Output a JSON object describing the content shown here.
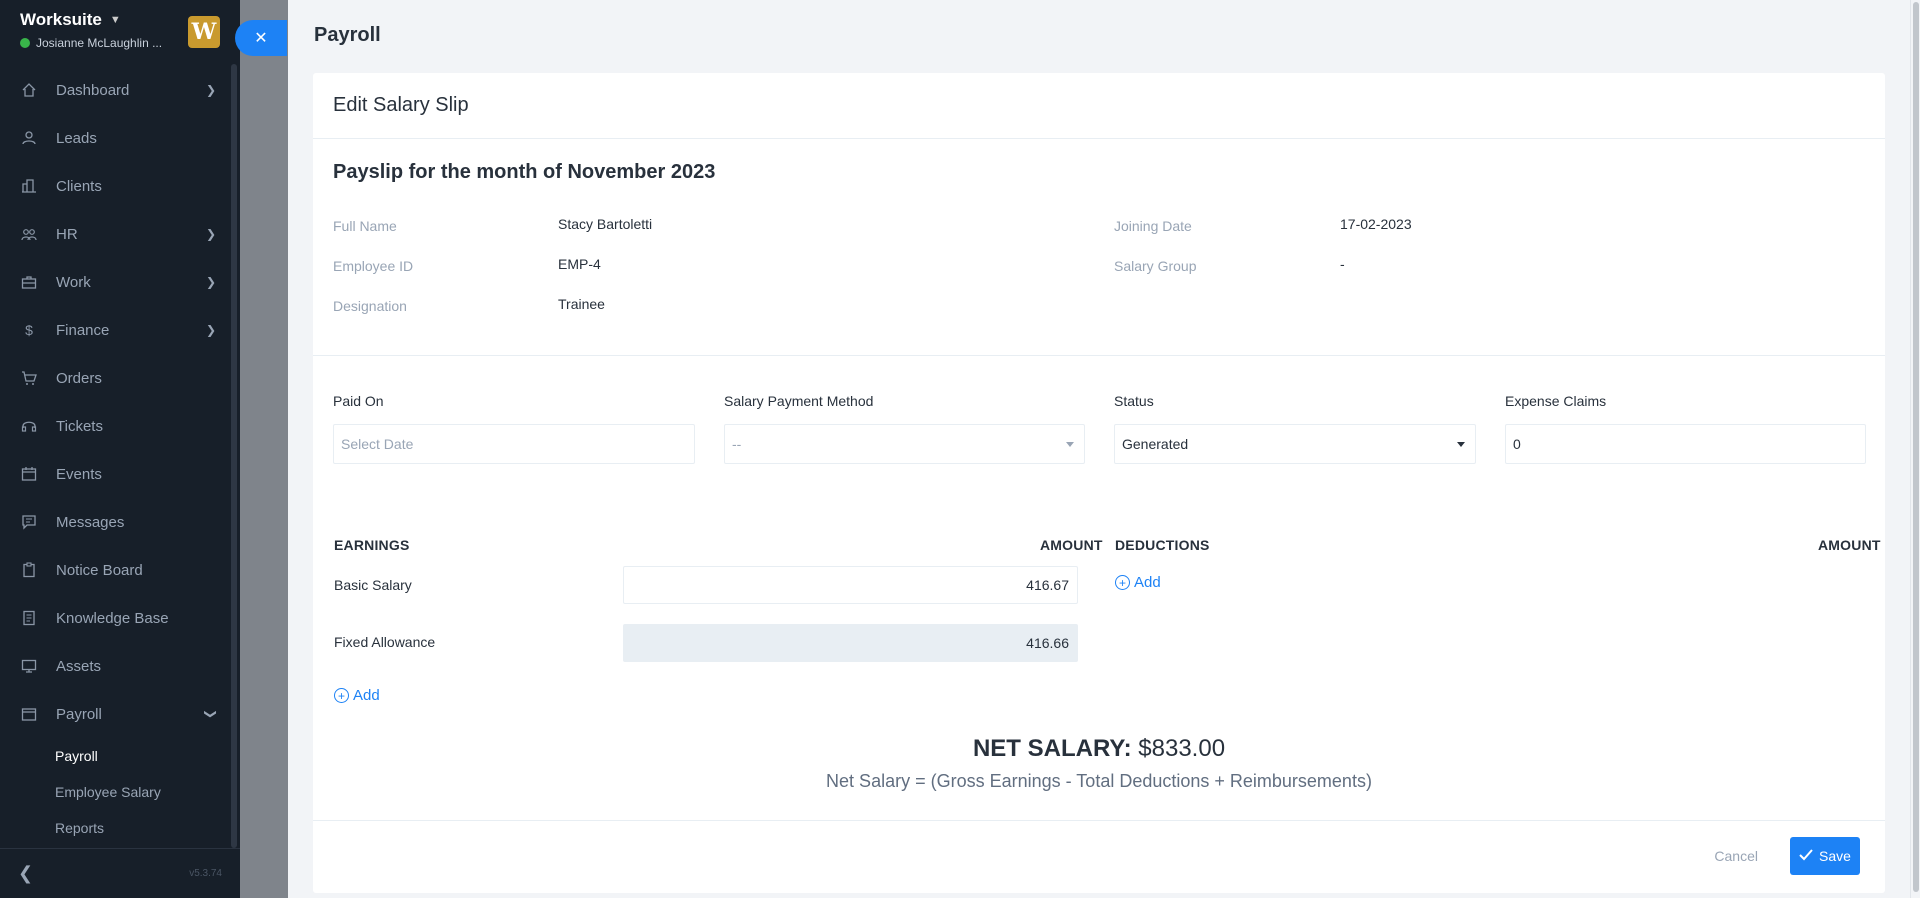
{
  "sidebar": {
    "brand": "Worksuite",
    "user": "Josianne McLaughlin ...",
    "logo_letter": "W",
    "version": "v5.3.74",
    "items": [
      {
        "label": "Dashboard",
        "icon": "home-icon",
        "arrow": true
      },
      {
        "label": "Leads",
        "icon": "person-icon",
        "arrow": false
      },
      {
        "label": "Clients",
        "icon": "building-icon",
        "arrow": false
      },
      {
        "label": "HR",
        "icon": "people-icon",
        "arrow": true
      },
      {
        "label": "Work",
        "icon": "briefcase-icon",
        "arrow": true
      },
      {
        "label": "Finance",
        "icon": "dollar-icon",
        "arrow": true
      },
      {
        "label": "Orders",
        "icon": "cart-icon",
        "arrow": false
      },
      {
        "label": "Tickets",
        "icon": "headset-icon",
        "arrow": false
      },
      {
        "label": "Events",
        "icon": "calendar-icon",
        "arrow": false
      },
      {
        "label": "Messages",
        "icon": "chat-icon",
        "arrow": false
      },
      {
        "label": "Notice Board",
        "icon": "clipboard-icon",
        "arrow": false
      },
      {
        "label": "Knowledge Base",
        "icon": "book-icon",
        "arrow": false
      },
      {
        "label": "Assets",
        "icon": "monitor-icon",
        "arrow": false
      },
      {
        "label": "Payroll",
        "icon": "wallet-icon",
        "arrow": "down"
      }
    ],
    "sub_items": [
      "Payroll",
      "Employee Salary",
      "Reports"
    ]
  },
  "panel": {
    "title": "Payroll",
    "card_title": "Edit Salary Slip",
    "payslip_title": "Payslip for the month of November 2023"
  },
  "employee": {
    "full_name_label": "Full Name",
    "full_name": "Stacy Bartoletti",
    "employee_id_label": "Employee ID",
    "employee_id": "EMP-4",
    "designation_label": "Designation",
    "designation": "Trainee",
    "joining_date_label": "Joining Date",
    "joining_date": "17-02-2023",
    "salary_group_label": "Salary Group",
    "salary_group": "-"
  },
  "form": {
    "paid_on_label": "Paid On",
    "paid_on_placeholder": "Select Date",
    "method_label": "Salary Payment Method",
    "method_value": "--",
    "status_label": "Status",
    "status_value": "Generated",
    "expense_label": "Expense Claims",
    "expense_value": "0"
  },
  "earnings": {
    "header": "EARNINGS",
    "amount_header": "AMOUNT",
    "rows": [
      {
        "label": "Basic Salary",
        "amount": "416.67"
      },
      {
        "label": "Fixed Allowance",
        "amount": "416.66"
      }
    ],
    "add_label": "Add"
  },
  "deductions": {
    "header": "DEDUCTIONS",
    "amount_header": "AMOUNT",
    "add_label": "Add"
  },
  "net": {
    "label": "NET SALARY:",
    "value": "$833.00",
    "formula": "Net Salary = (Gross Earnings - Total Deductions + Reimbursements)"
  },
  "footer": {
    "cancel_label": "Cancel",
    "save_label": "Save"
  },
  "colors": {
    "accent": "#1d82f5",
    "sidebar_bg": "#171f29",
    "status_online": "#39b54a"
  }
}
